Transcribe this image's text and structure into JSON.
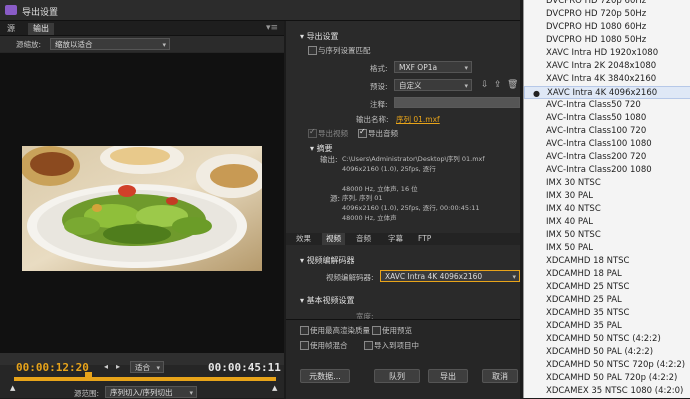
{
  "window": {
    "title": "导出设置"
  },
  "left": {
    "tabs": [
      "源",
      "输出"
    ],
    "source_scaling_label": "源缩放:",
    "source_scaling_value": "缩放以适合",
    "timecode_in": "00:00:12:20",
    "timecode_out": "00:00:45:11",
    "fit_value": "适合",
    "source_range_label": "源范围:",
    "source_range_value": "序列切入/序列切出"
  },
  "right": {
    "export_settings_title": "导出设置",
    "match_sequence_label": "与序列设置匹配",
    "format_label": "格式:",
    "format_value": "MXF OP1a",
    "preset_label": "预设:",
    "preset_value": "自定义",
    "comment_label": "注释:",
    "output_name_label": "输出名称:",
    "output_name_value": "序列 01.mxf",
    "export_video_label": "导出视频",
    "export_audio_label": "导出音频",
    "summary_title": "摘要",
    "output_key": "输出:",
    "output_lines": [
      "C:\\Users\\Administrator\\Desktop\\序列 01.mxf",
      "4096x2160 (1.0), 25fps, 逐行",
      "",
      "48000 Hz, 立体声, 16 位"
    ],
    "source_key": "源:",
    "source_lines": [
      "序列, 序列 01",
      "4096x2160 (1.0), 25fps, 逐行, 00:00:45:11",
      "48000 Hz, 立体声"
    ],
    "subtabs": [
      "效果",
      "视频",
      "音频",
      "字幕",
      "FTP"
    ],
    "video_codec_section": "视频编解码器",
    "video_codec_label": "视频编解码器:",
    "video_codec_value": "XAVC Intra 4K 4096x2160",
    "basic_video_section": "基本视频设置",
    "width_label": "宽度:",
    "max_render_quality": "使用最高渲染质量",
    "use_previews": "使用预览",
    "use_frame_blending": "使用帧混合",
    "import_into_project": "导入到项目中",
    "metadata_button": "元数据...",
    "queue_button": "队列",
    "export_button": "导出",
    "cancel_button": "取消"
  },
  "menu": {
    "items": [
      "DVCPRO HD 720p 60Hz",
      "DVCPRO HD 720p 50Hz",
      "DVCPRO HD 1080 60Hz",
      "DVCPRO HD 1080 50Hz",
      "XAVC Intra HD 1920x1080",
      "XAVC Intra 2K 2048x1080",
      "XAVC Intra 4K 3840x2160",
      "XAVC Intra 4K 4096x2160",
      "AVC-Intra Class50 720",
      "AVC-Intra Class50 1080",
      "AVC-Intra Class100 720",
      "AVC-Intra Class100 1080",
      "AVC-Intra Class200 720",
      "AVC-Intra Class200 1080",
      "IMX 30 NTSC",
      "IMX 30 PAL",
      "IMX 40 NTSC",
      "IMX 40 PAL",
      "IMX 50 NTSC",
      "IMX 50 PAL",
      "XDCAMHD 18 NTSC",
      "XDCAMHD 18 PAL",
      "XDCAMHD 25 NTSC",
      "XDCAMHD 25 PAL",
      "XDCAMHD 35 NTSC",
      "XDCAMHD 35 PAL",
      "XDCAMHD 50 NTSC (4:2:2)",
      "XDCAMHD 50 PAL (4:2:2)",
      "XDCAMHD 50 NTSC 720p (4:2:2)",
      "XDCAMHD 50 PAL 720p (4:2:2)",
      "XDCAMEX 35 NTSC 1080 (4:2:0)"
    ],
    "selected_index": 7
  },
  "colors": {
    "accent": "#e8a41a",
    "timecode": "#e8a41a",
    "menu_bg": "#f4f4f4",
    "menu_selected": "#dfe8f6"
  }
}
